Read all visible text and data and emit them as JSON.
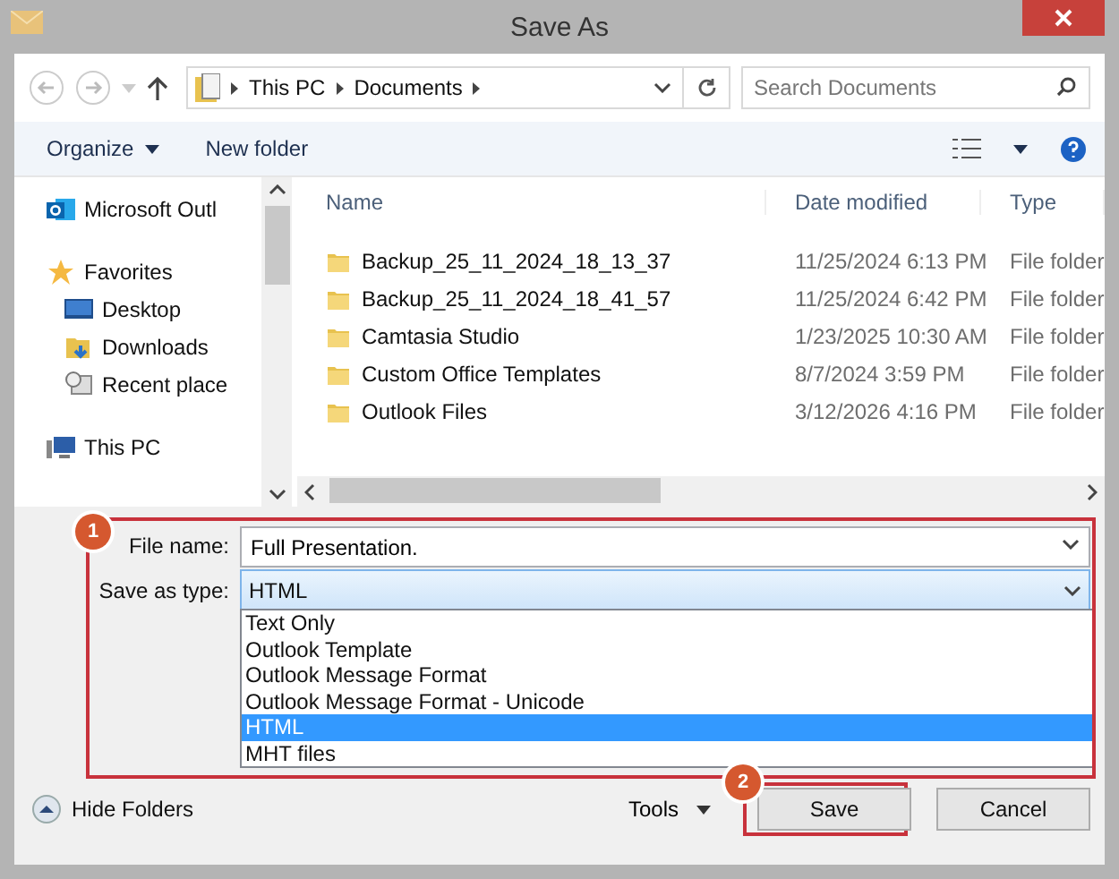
{
  "window": {
    "title": "Save As"
  },
  "nav": {
    "path": [
      "This PC",
      "Documents"
    ],
    "search_placeholder": "Search Documents"
  },
  "toolbar": {
    "organize": "Organize",
    "new_folder": "New folder"
  },
  "sidebar": {
    "items": [
      {
        "label": "Microsoft Outl",
        "kind": "outlook"
      },
      {
        "label": "Favorites",
        "kind": "star",
        "children": [
          {
            "label": "Desktop",
            "kind": "desktop"
          },
          {
            "label": "Downloads",
            "kind": "downloads"
          },
          {
            "label": "Recent place",
            "kind": "recent"
          }
        ]
      },
      {
        "label": "This PC",
        "kind": "pc"
      }
    ]
  },
  "table": {
    "columns": [
      "Name",
      "Date modified",
      "Type"
    ],
    "rows": [
      {
        "name": "Backup_25_11_2024_18_13_37",
        "date": "11/25/2024 6:13 PM",
        "type": "File folder"
      },
      {
        "name": "Backup_25_11_2024_18_41_57",
        "date": "11/25/2024 6:42 PM",
        "type": "File folder"
      },
      {
        "name": "Camtasia Studio",
        "date": "1/23/2025 10:30 AM",
        "type": "File folder"
      },
      {
        "name": "Custom Office Templates",
        "date": "8/7/2024 3:59 PM",
        "type": "File folder"
      },
      {
        "name": "Outlook Files",
        "date": "3/12/2026 4:16 PM",
        "type": "File folder"
      }
    ]
  },
  "form": {
    "file_name_label": "File name:",
    "file_name": "Full Presentation.",
    "type_label": "Save as type:",
    "type_value": "HTML",
    "options": [
      {
        "label": "Text Only",
        "selected": false
      },
      {
        "label": "Outlook Template",
        "selected": false
      },
      {
        "label": "Outlook Message Format",
        "selected": false
      },
      {
        "label": "Outlook Message Format - Unicode",
        "selected": false
      },
      {
        "label": "HTML",
        "selected": true
      },
      {
        "label": "MHT files",
        "selected": false
      }
    ]
  },
  "footer": {
    "hide_folders": "Hide Folders",
    "tools": "Tools",
    "save": "Save",
    "cancel": "Cancel"
  },
  "callouts": [
    "1",
    "2"
  ]
}
